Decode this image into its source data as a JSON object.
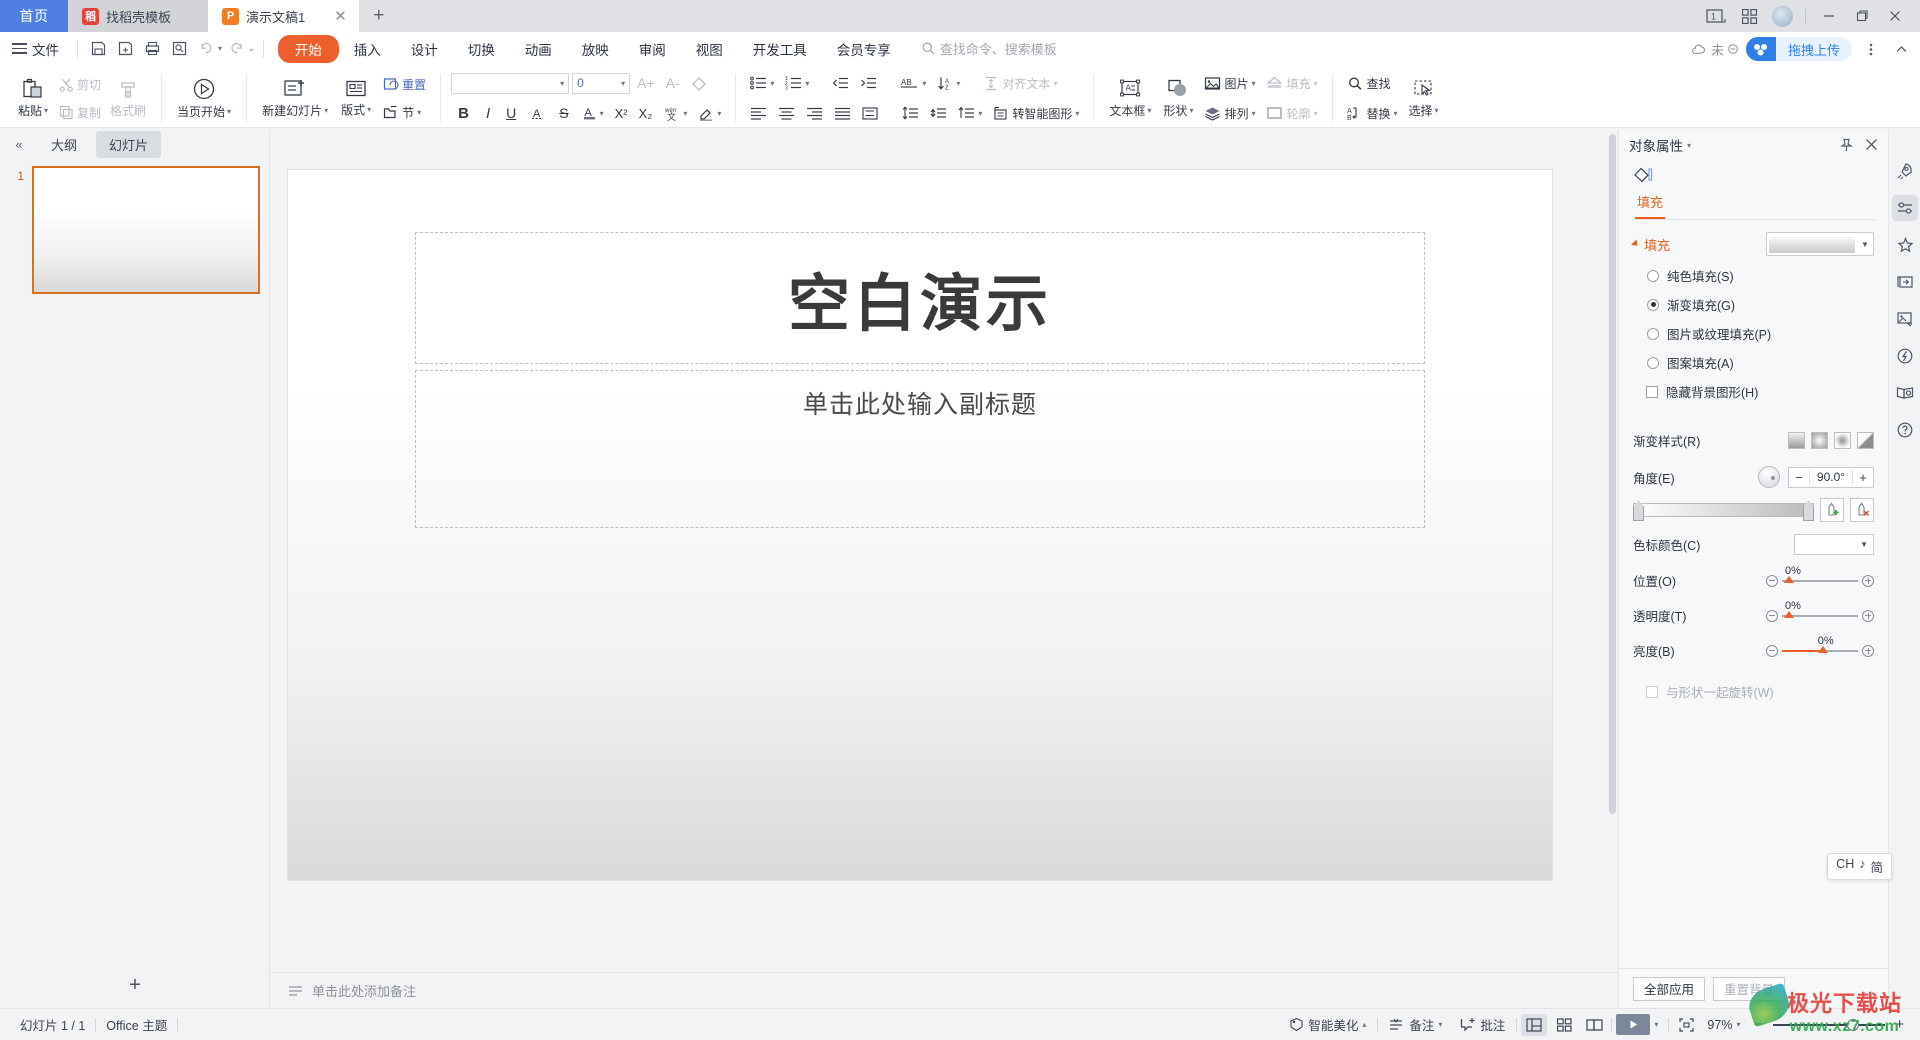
{
  "tabbar": {
    "home_label": "首页",
    "tabs": [
      {
        "label": "找稻壳模板",
        "icon": "kdocs-icon"
      },
      {
        "label": "演示文稿1",
        "icon": "presentation-icon"
      }
    ],
    "new_tab_label": "+",
    "window_count": "1"
  },
  "menubar": {
    "file_label": "文件",
    "quick_access": [
      "save-icon",
      "save-as-icon",
      "print-icon",
      "print-preview-icon",
      "undo-icon",
      "redo-icon",
      "customize-icon"
    ],
    "menus": [
      {
        "label": "开始",
        "active": true
      },
      {
        "label": "插入",
        "active": false
      },
      {
        "label": "设计",
        "active": false
      },
      {
        "label": "切换",
        "active": false
      },
      {
        "label": "动画",
        "active": false
      },
      {
        "label": "放映",
        "active": false
      },
      {
        "label": "审阅",
        "active": false
      },
      {
        "label": "视图",
        "active": false
      },
      {
        "label": "开发工具",
        "active": false
      },
      {
        "label": "会员专享",
        "active": false
      }
    ],
    "search_placeholder": "查找命令、搜索模板",
    "cloud_status": "未",
    "upload_label": "拖拽上传",
    "accent": "#ed5f2c"
  },
  "ribbon": {
    "clipboard": {
      "paste": "粘贴",
      "cut": "剪切",
      "copy": "复制",
      "format_painter": "格式刷"
    },
    "present": {
      "from_current": "当页开始"
    },
    "slides": {
      "new_slide": "新建幻灯片",
      "layout": "版式",
      "reset": "重置",
      "section": "节"
    },
    "font": {
      "family_value": "",
      "size_value": "0",
      "grow": "A+",
      "shrink": "A-",
      "clear_format": "clear-format-icon",
      "bold": "B",
      "italic": "I",
      "underline": "U",
      "char_border": "A",
      "strikethrough": "S",
      "font_color": "A",
      "superscript": "X²",
      "subscript": "X₂",
      "wen_case": "文",
      "highlight": "highlight-icon"
    },
    "paragraph": {
      "bullets": "bullet-list-icon",
      "numbering": "numbered-list-icon",
      "decrease_indent": "decrease-indent-icon",
      "increase_indent": "increase-indent-icon",
      "text_direction": "AB",
      "sort": "sort-icon",
      "align_text": "对齐文本",
      "align_left": "align-left-icon",
      "align_center": "align-center-icon",
      "align_right": "align-right-icon",
      "justify": "justify-icon",
      "distribute": "distribute-icon",
      "line_spacing": "line-spacing-icon",
      "para_spacing": "para-spacing-icon",
      "spacing_more": "spacing-more-icon",
      "to_smartart": "转智能图形"
    },
    "drawing": {
      "textbox": "文本框",
      "shape": "形状",
      "picture": "图片",
      "arrange": "排列",
      "fill": "填充",
      "outline": "轮廓"
    },
    "editing": {
      "find": "查找",
      "replace": "替换",
      "select": "选择"
    }
  },
  "slide_panel": {
    "collapse_icon": "collapse-left-icon",
    "tabs": [
      {
        "label": "大纲",
        "active": false
      },
      {
        "label": "幻灯片",
        "active": true
      }
    ],
    "thumbnails": [
      {
        "number": "1"
      }
    ],
    "add_slide_label": "+"
  },
  "slide": {
    "title": "空白演示",
    "subtitle": "单击此处输入副标题",
    "notes_placeholder": "单击此处添加备注"
  },
  "properties_panel": {
    "title": "对象属性",
    "pin_icon": "pin-icon",
    "close_icon": "close-icon",
    "tab_label": "填充",
    "section_title": "填充",
    "fill_options": [
      {
        "label": "纯色填充(S)",
        "selected": false
      },
      {
        "label": "渐变填充(G)",
        "selected": true
      },
      {
        "label": "图片或纹理填充(P)",
        "selected": false
      },
      {
        "label": "图案填充(A)",
        "selected": false
      }
    ],
    "hide_bg_graphics": {
      "label": "隐藏背景图形(H)",
      "checked": false
    },
    "gradient_style_label": "渐变样式(R)",
    "angle_label": "角度(E)",
    "angle_value": "90.0°",
    "stop_color_label": "色标颜色(C)",
    "sliders": [
      {
        "label": "位置(O)",
        "value": "0%",
        "fill_pct": 7
      },
      {
        "label": "透明度(T)",
        "value": "0%",
        "fill_pct": 7
      },
      {
        "label": "亮度(B)",
        "value": "0%",
        "fill_pct": 52
      }
    ],
    "rotate_with_shape": {
      "label": "与形状一起旋转(W)",
      "checked": false
    },
    "apply_all_label": "全部应用",
    "reset_bg_label": "重置背景",
    "accent": "#e8601f"
  },
  "rail": {
    "icons": [
      {
        "name": "rocket-icon",
        "selected": false
      },
      {
        "name": "sliders-icon",
        "selected": true
      },
      {
        "name": "star-sparkle-icon",
        "selected": false
      },
      {
        "name": "screen-share-icon",
        "selected": false
      },
      {
        "name": "image-tools-icon",
        "selected": false
      },
      {
        "name": "lightbulb-icon",
        "selected": false
      },
      {
        "name": "book-search-icon",
        "selected": false
      },
      {
        "name": "help-icon",
        "selected": false
      }
    ]
  },
  "statusbar": {
    "slide_count": "幻灯片 1 / 1",
    "theme": "Office 主题",
    "beautify": "智能美化",
    "notes": "备注",
    "comment": "批注",
    "views": [
      "normal-view-icon",
      "slide-sorter-icon",
      "reading-view-icon"
    ],
    "play_icon": "play-icon",
    "fit_icon": "fit-to-window-icon",
    "zoom": "97%",
    "zoom_out": "−",
    "zoom_in": "+"
  },
  "ime": {
    "lang": "CH",
    "mode_icon": "♪",
    "style": "简"
  },
  "watermark": {
    "line1": "极光下载站",
    "line2": "www.xz7.com"
  }
}
